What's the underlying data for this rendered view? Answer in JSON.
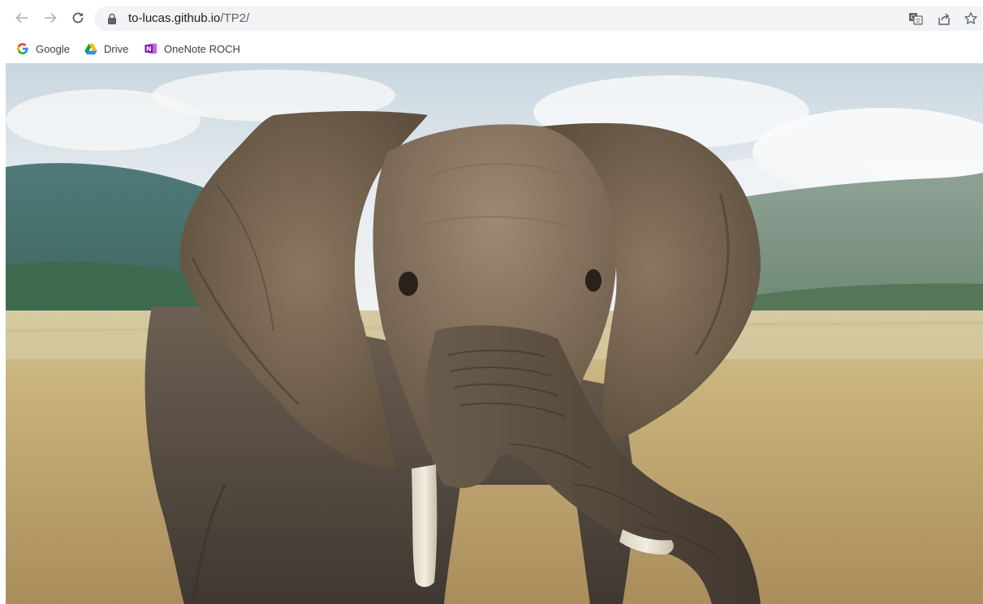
{
  "browser": {
    "url_host": "to-lucas.github.io",
    "url_path": "/TP2/",
    "icons": {
      "back": "back-arrow-icon",
      "forward": "forward-arrow-icon",
      "reload": "reload-icon",
      "lock": "lock-icon",
      "translate": "translate-icon",
      "share": "share-icon",
      "bookmark_star": "star-icon"
    }
  },
  "bookmarks": [
    {
      "label": "Google",
      "icon": "google-icon"
    },
    {
      "label": "Drive",
      "icon": "google-drive-icon"
    },
    {
      "label": "OneNote ROCH",
      "icon": "onenote-icon"
    }
  ],
  "page": {
    "image": {
      "subject": "elephant",
      "icon": "photo-image"
    }
  }
}
